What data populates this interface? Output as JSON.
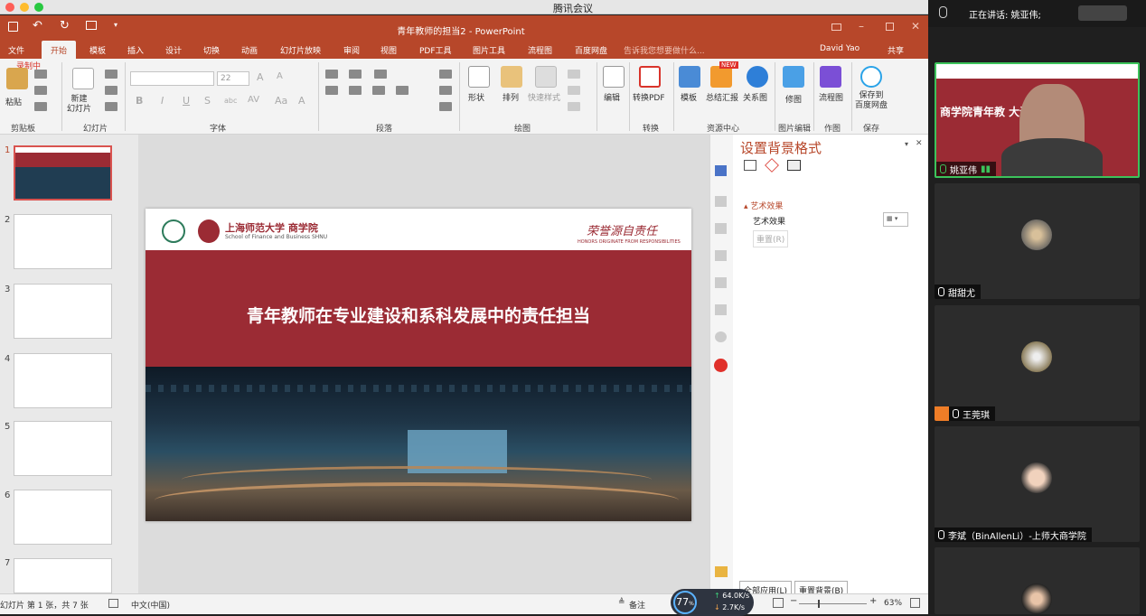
{
  "window": {
    "title": "腾讯会议"
  },
  "ppt": {
    "title": "青年教师的担当2 - PowerPoint",
    "user": "David Yao",
    "share": "共享",
    "tell_me": "告诉我您想要做什么...",
    "tabs": [
      "文件",
      "开始",
      "模板",
      "插入",
      "设计",
      "切换",
      "动画",
      "幻灯片放映",
      "审阅",
      "视图",
      "PDF工具",
      "图片工具",
      "流程图",
      "百度网盘"
    ],
    "recording": "录制中",
    "ribbon": {
      "paste": "粘贴",
      "new_slide": "新建\n幻灯片",
      "font_name": "",
      "font_size": "22",
      "shape": "形状",
      "arrange": "排列",
      "quick_style": "快速样式",
      "edit": "编辑",
      "to_pdf": "转换PDF",
      "template": "模板",
      "summary": "总结汇报",
      "relation": "关系图",
      "beautify": "修图",
      "flowchart": "流程图",
      "save_baidu": "保存到\n百度网盘",
      "new_badge": "NEW",
      "groups": [
        "剪贴板",
        "幻灯片",
        "字体",
        "段落",
        "绘图",
        "转换",
        "资源中心",
        "图片编辑",
        "作图",
        "保存"
      ]
    },
    "slide_numbers": [
      "1",
      "2",
      "3",
      "4",
      "5",
      "6",
      "7"
    ],
    "slide": {
      "school": "上海师范大学 商学院",
      "school_en": "School of Finance and Business SHNU",
      "motto": "荣誉源自责任",
      "motto_en": "HONORS ORIGINATE FROM RESPONSIBILITIES",
      "headline": "青年教师在专业建设和系科发展中的责任担当"
    },
    "format_pane": {
      "title": "设置背景格式",
      "section": "艺术效果",
      "row_label": "艺术效果",
      "reset": "重置(R)",
      "apply_all": "全部应用(L)",
      "reset_bg": "重置背景(B)"
    },
    "status": {
      "slide_info": "幻灯片 第 1 张，共 7 张",
      "language": "中文(中国)",
      "notes": "备注",
      "zoom": "63%",
      "cpu": "77",
      "up": "64.0K/s",
      "down": "2.7K/s"
    }
  },
  "meeting": {
    "speaking": "正在讲话: 姚亚伟;",
    "participants": [
      {
        "name": "姚亚伟",
        "tile_text": "商学院青年教  大讨论"
      },
      {
        "name": "甜甜尤"
      },
      {
        "name": "王莞琪"
      },
      {
        "name": "李斌（BinAllenLi）-上师大商学院"
      },
      {
        "name": ""
      }
    ]
  },
  "colors": {
    "ppt_accent": "#b7472a",
    "slide_red": "#9b2b34",
    "active_speaker": "#3cc35b"
  }
}
